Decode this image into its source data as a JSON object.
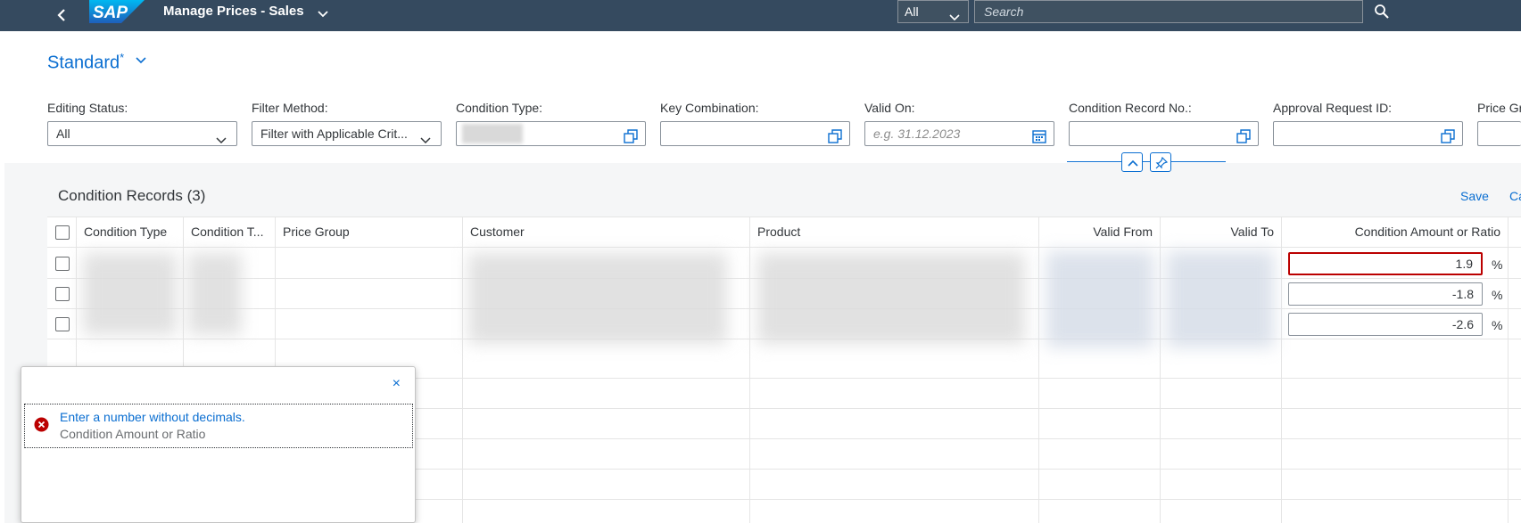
{
  "shell": {
    "logo_text": "SAP",
    "app_title": "Manage Prices - Sales",
    "search_scope": "All",
    "search_placeholder": "Search"
  },
  "variant": {
    "name": "Standard",
    "modified_marker": "*"
  },
  "filterbar": {
    "fields": [
      {
        "label": "Editing Status:",
        "value": "All"
      },
      {
        "label": "Filter Method:",
        "value": "Filter with Applicable Crit..."
      },
      {
        "label": "Condition Type:",
        "value": ""
      },
      {
        "label": "Key Combination:",
        "value": ""
      },
      {
        "label": "Valid On:",
        "value": "e.g. 31.12.2023"
      },
      {
        "label": "Condition Record No.:",
        "value": ""
      },
      {
        "label": "Approval Request ID:",
        "value": ""
      },
      {
        "label": "Price Gr",
        "value": ""
      }
    ]
  },
  "table": {
    "title": "Condition Records (3)",
    "actions": {
      "save": "Save",
      "cancel": "Ca"
    },
    "columns": [
      "Condition Type",
      "Condition T...",
      "Price Group",
      "Customer",
      "Product",
      "Valid From",
      "Valid To",
      "Condition Amount or Ratio"
    ],
    "rows": [
      {
        "amount": "1.9",
        "unit": "%",
        "error": true
      },
      {
        "amount": "-1.8",
        "unit": "%",
        "error": false
      },
      {
        "amount": "-2.6",
        "unit": "%",
        "error": false
      }
    ]
  },
  "message_popover": {
    "close_glyph": "×",
    "messages": [
      {
        "type": "error",
        "title": "Enter a number without decimals.",
        "subtitle": "Condition Amount or Ratio"
      }
    ]
  },
  "colors": {
    "shell": "#354a5f",
    "link": "#0a6ed1",
    "error": "#bb0000"
  }
}
